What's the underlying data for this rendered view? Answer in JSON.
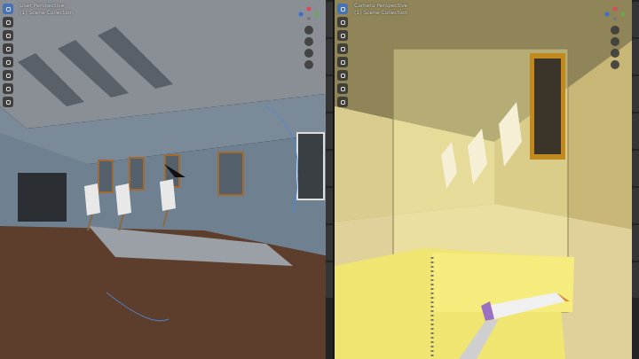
{
  "viewports": [
    {
      "header": "User Perspective",
      "collection": "(1) Scene Collection",
      "shading": "solid",
      "tools": [
        {
          "selected": true
        },
        {
          "selected": false
        },
        {
          "selected": false
        },
        {
          "selected": false
        },
        {
          "selected": false
        },
        {
          "selected": false
        },
        {
          "selected": false
        },
        {
          "selected": false
        }
      ],
      "side_tabs": 8
    },
    {
      "header": "Camera Perspective",
      "collection": "(1) Scene Collection",
      "shading": "camera",
      "tools": [
        {
          "selected": true
        },
        {
          "selected": false
        },
        {
          "selected": false
        },
        {
          "selected": false
        },
        {
          "selected": false
        },
        {
          "selected": false
        },
        {
          "selected": false
        },
        {
          "selected": false
        }
      ],
      "side_tabs": 8
    }
  ]
}
